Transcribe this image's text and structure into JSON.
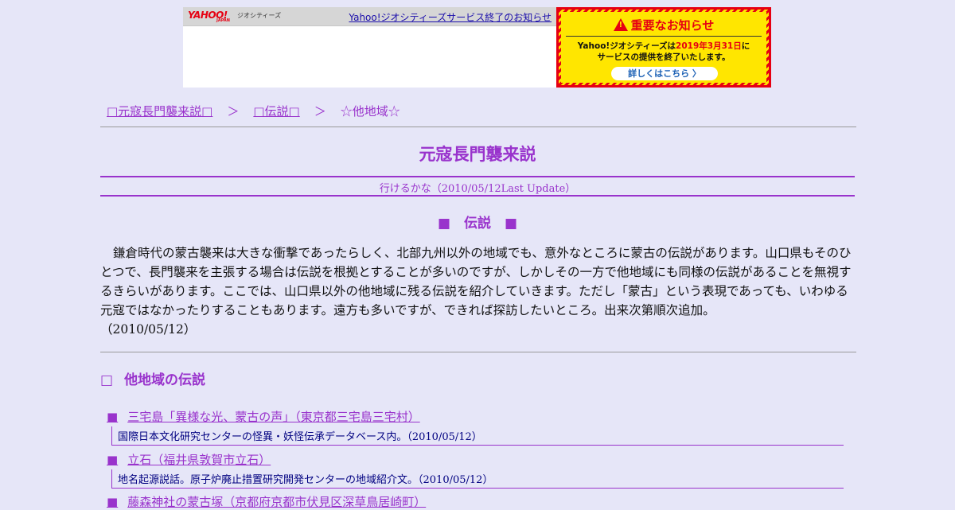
{
  "banner": {
    "logo_text": "YAHOO!",
    "logo_sub": "JAPAN",
    "service_label": "ジオシティーズ",
    "link_text": "Yahoo!ジオシティーズサービス終了のお知らせ"
  },
  "notice": {
    "title": "重要なお知らせ",
    "body_prefix": "Yahoo!ジオシティーズは",
    "body_date": "2019年3月31日",
    "body_mid": "に",
    "body_line2": "サービスの提供を終了いたします。",
    "button_label": "詳しくはこちら 〉"
  },
  "breadcrumb": {
    "items": [
      "□元寇長門襲来説□",
      "□伝説□",
      "☆他地域☆"
    ],
    "separator": "＞"
  },
  "page": {
    "title": "元寇長門襲来説",
    "update": "行けるかな（2010/05/12Last Update）",
    "section_heading": "■　伝説　■",
    "intro": "鎌倉時代の蒙古襲来は大きな衝撃であったらしく、北部九州以外の地域でも、意外なところに蒙古の伝説があります。山口県もそのひとつで、長門襲来を主張する場合は伝説を根拠とすることが多いのですが、しかしその一方で他地域にも同様の伝説があることを無視するきらいがあります。ここでは、山口県以外の他地域に残る伝説を紹介していきます。ただし「蒙古」という表現であっても、いわゆる元寇ではなかったりすることもあります。遠方も多いですが、できれば探訪したいところ。出来次第順次追加。",
    "intro_date": "（2010/05/12）",
    "sub_heading_mark": "□",
    "sub_heading": "他地域の伝説"
  },
  "entries": [
    {
      "bullet": "■",
      "title": "三宅島「異様な光、蒙古の声」（東京都三宅島三宅村）",
      "desc": "国際日本文化研究センターの怪異・妖怪伝承データベース内。",
      "date": "（2010/05/12）"
    },
    {
      "bullet": "■",
      "title": "立石（福井県敦賀市立石）",
      "desc": "地名起源説話。原子炉廃止措置研究開発センターの地域紹介文。",
      "date": "（2010/05/12）"
    },
    {
      "bullet": "■",
      "title": "藤森神社の蒙古塚（京都府京都市伏見区深草鳥居崎町）"
    }
  ],
  "colors": {
    "accent": "#9933cc",
    "background": "#e6e6f8",
    "link_blue": "#000080",
    "notice_red": "#e60012",
    "notice_yellow": "#ffe600"
  }
}
